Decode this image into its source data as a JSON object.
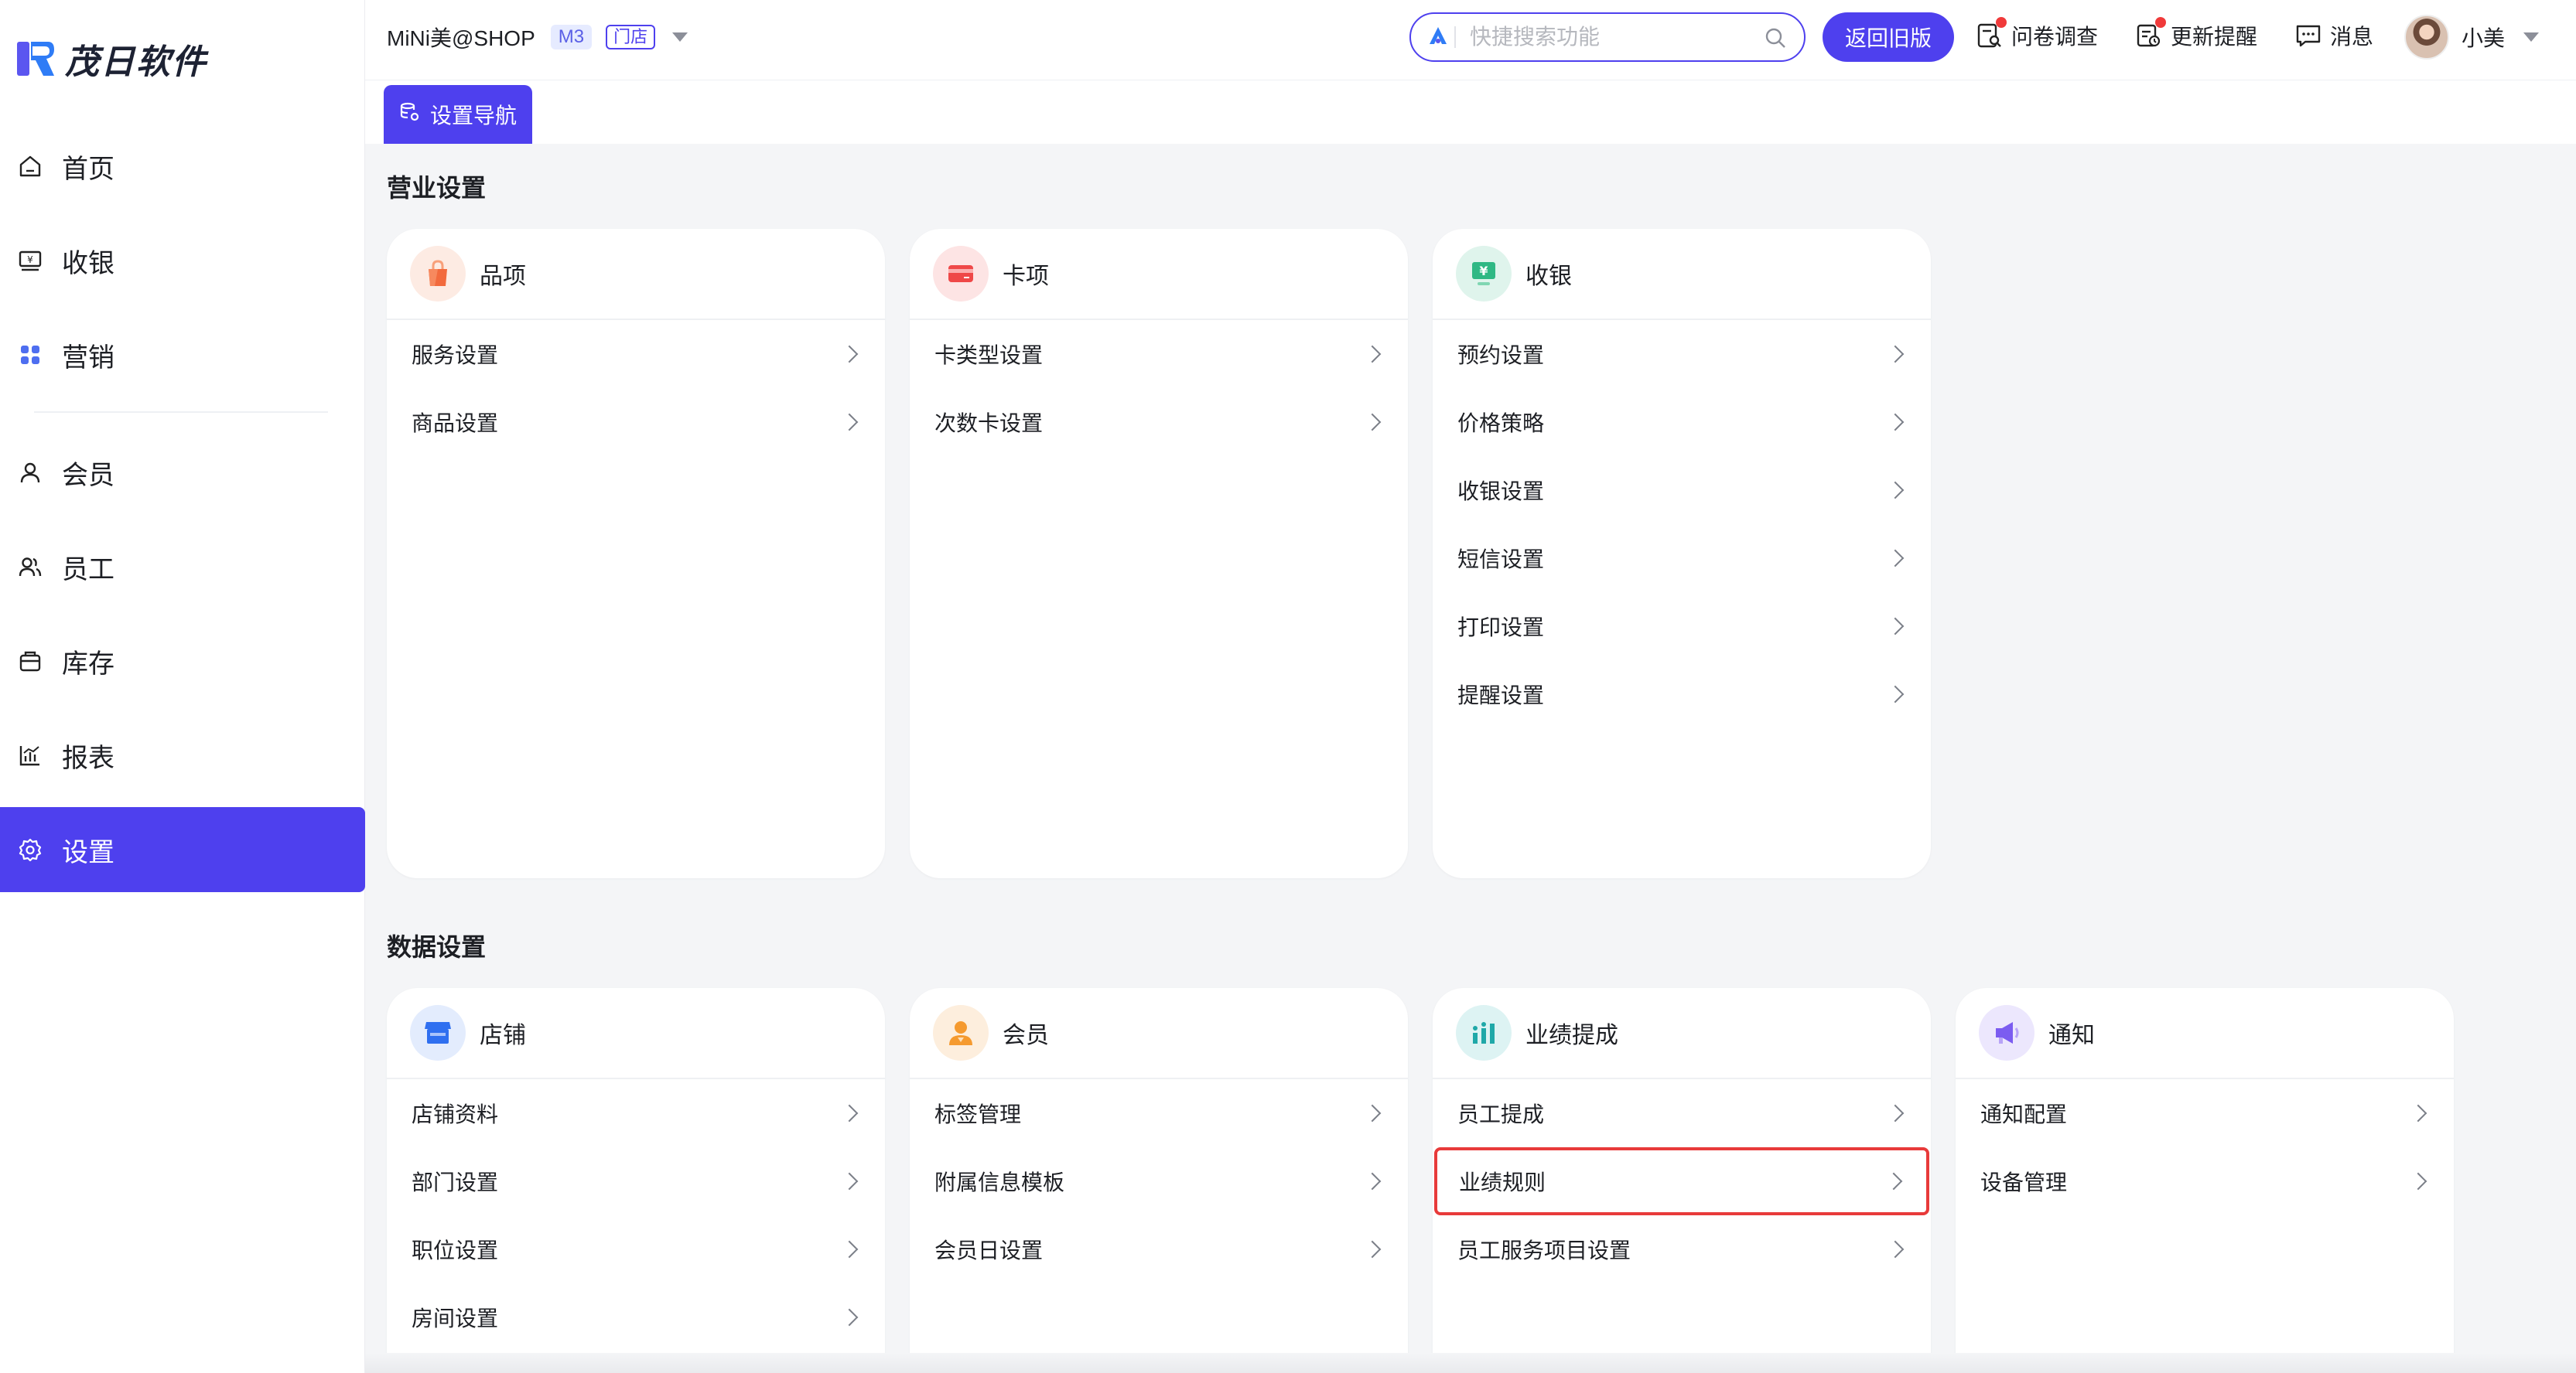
{
  "app": {
    "brand": "茂日软件"
  },
  "sidebar": {
    "items": [
      {
        "label": "首页",
        "icon": "home-icon"
      },
      {
        "label": "收银",
        "icon": "cashier-icon"
      },
      {
        "label": "营销",
        "icon": "marketing-icon"
      },
      {
        "label": "会员",
        "icon": "member-icon"
      },
      {
        "label": "员工",
        "icon": "staff-icon"
      },
      {
        "label": "库存",
        "icon": "inventory-icon"
      },
      {
        "label": "报表",
        "icon": "report-icon"
      },
      {
        "label": "设置",
        "icon": "gear-icon",
        "active": true
      }
    ]
  },
  "header": {
    "shop_name": "MiNi美@SHOP",
    "version_badge": "M3",
    "store_badge": "门店",
    "search_placeholder": "快捷搜索功能",
    "old_version_button": "返回旧版",
    "survey": "问卷调查",
    "update_reminder": "更新提醒",
    "messages": "消息",
    "username": "小美"
  },
  "tab": {
    "label": "设置导航"
  },
  "sections": [
    {
      "title": "营业设置",
      "cards": [
        {
          "title": "品项",
          "icon": "bag-icon",
          "items": [
            "服务设置",
            "商品设置"
          ]
        },
        {
          "title": "卡项",
          "icon": "card-icon",
          "items": [
            "卡类型设置",
            "次数卡设置"
          ]
        },
        {
          "title": "收银",
          "icon": "yen-monitor-icon",
          "items": [
            "预约设置",
            "价格策略",
            "收银设置",
            "短信设置",
            "打印设置",
            "提醒设置"
          ]
        }
      ]
    },
    {
      "title": "数据设置",
      "cards": [
        {
          "title": "店铺",
          "icon": "store-icon",
          "items": [
            "店铺资料",
            "部门设置",
            "职位设置",
            "房间设置"
          ]
        },
        {
          "title": "会员",
          "icon": "person-icon",
          "items": [
            "标签管理",
            "附属信息模板",
            "会员日设置"
          ]
        },
        {
          "title": "业绩提成",
          "icon": "bar-chart-icon",
          "items": [
            "员工提成",
            "业绩规则",
            "员工服务项目设置"
          ],
          "highlighted_item": "业绩规则"
        },
        {
          "title": "通知",
          "icon": "megaphone-icon",
          "items": [
            "通知配置",
            "设备管理"
          ]
        }
      ]
    }
  ],
  "colors": {
    "accent": "#4e40ee",
    "highlight": "#e83a3a"
  }
}
